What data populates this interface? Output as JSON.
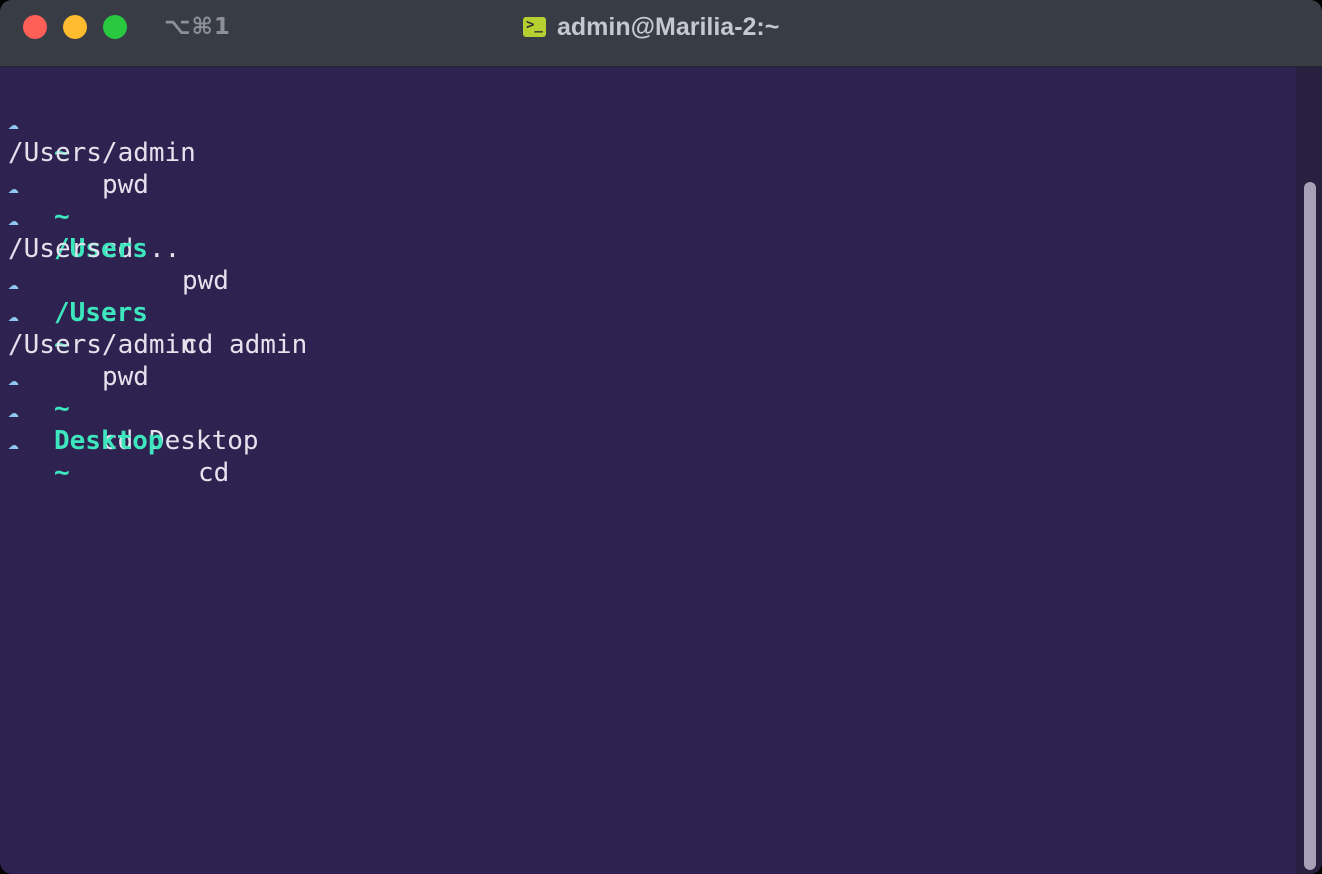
{
  "window": {
    "shortcut": "⌥⌘1",
    "title": "admin@Marilia-2:~",
    "terminal_icon": "terminal-icon"
  },
  "colors": {
    "background": "#2e2350",
    "titlebar": "#383c45",
    "cwd": "#3ee6bd",
    "prompt_icon": "#8fc6f2",
    "text": "#e4e2ec"
  },
  "terminal": {
    "prompt_symbol": "☁",
    "lines": [
      {
        "type": "prompt",
        "cwd": "~",
        "cmd": "pwd"
      },
      {
        "type": "output",
        "text": "/Users/admin"
      },
      {
        "type": "prompt",
        "cwd": "~",
        "cmd": "cd .."
      },
      {
        "type": "prompt",
        "cwd": "/Users",
        "cmd": "pwd"
      },
      {
        "type": "output",
        "text": "/Users"
      },
      {
        "type": "prompt",
        "cwd": "/Users",
        "cmd": "cd admin"
      },
      {
        "type": "prompt",
        "cwd": "~",
        "cmd": "pwd"
      },
      {
        "type": "output",
        "text": "/Users/admin"
      },
      {
        "type": "prompt",
        "cwd": "~",
        "cmd": "cd Desktop"
      },
      {
        "type": "prompt",
        "cwd": "Desktop",
        "cmd": "cd"
      },
      {
        "type": "prompt",
        "cwd": "~",
        "cmd": ""
      }
    ]
  }
}
